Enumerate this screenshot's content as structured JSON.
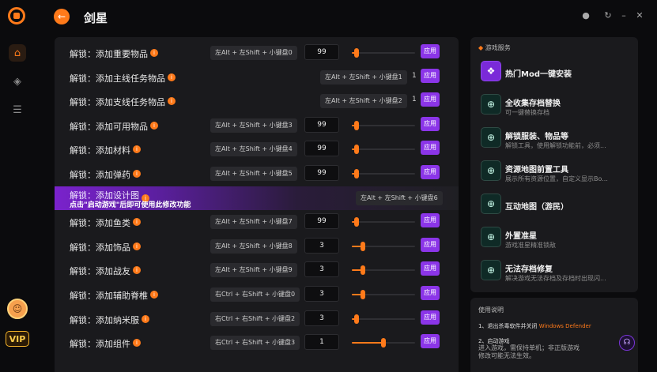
{
  "app": {
    "title": "剑星",
    "vip": "VIP"
  },
  "rows": [
    {
      "label": "解锁：添加重要物品",
      "keys": "左Alt + 左Shift + 小键盘0",
      "value": "99",
      "slider": 0.08,
      "apply": "应用"
    },
    {
      "label": "解锁：添加主线任务物品",
      "keys": "左Alt + 左Shift + 小键盘1",
      "count": "1",
      "apply": "应用"
    },
    {
      "label": "解锁：添加支线任务物品",
      "keys": "左Alt + 左Shift + 小键盘2",
      "count": "1",
      "apply": "应用"
    },
    {
      "label": "解锁：添加可用物品",
      "keys": "左Alt + 左Shift + 小键盘3",
      "value": "99",
      "slider": 0.08,
      "apply": "应用"
    },
    {
      "label": "解锁：添加材料",
      "keys": "左Alt + 左Shift + 小键盘4",
      "value": "99",
      "slider": 0.08,
      "apply": "应用"
    },
    {
      "label": "解锁：添加弹药",
      "keys": "左Alt + 左Shift + 小键盘5",
      "value": "99",
      "slider": 0.08,
      "apply": "应用"
    },
    {
      "label": "解锁：添加设计图",
      "sub": "点击\"启动游戏\"后即可使用此修改功能",
      "keys": "左Alt + 左Shift + 小键盘6",
      "highlight": true
    },
    {
      "label": "解锁：添加鱼类",
      "keys": "左Alt + 左Shift + 小键盘7",
      "value": "99",
      "slider": 0.08,
      "apply": "应用"
    },
    {
      "label": "解锁：添加饰品",
      "keys": "左Alt + 左Shift + 小键盘8",
      "value": "3",
      "slider": 0.18,
      "apply": "应用"
    },
    {
      "label": "解锁：添加战友",
      "keys": "左Alt + 左Shift + 小键盘9",
      "value": "3",
      "slider": 0.18,
      "apply": "应用"
    },
    {
      "label": "解锁：添加辅助脊椎",
      "keys": "右Ctrl + 右Shift + 小键盘0",
      "value": "3",
      "slider": 0.18,
      "apply": "应用"
    },
    {
      "label": "解锁：添加纳米服",
      "keys": "右Ctrl + 右Shift + 小键盘2",
      "value": "3",
      "slider": 0.08,
      "apply": "应用"
    },
    {
      "label": "解锁：添加组件",
      "keys": "右Ctrl + 右Shift + 小键盘3",
      "value": "1",
      "slider": 0.5,
      "apply": "应用"
    }
  ],
  "services": {
    "title": "游戏服务",
    "items": [
      {
        "name": "热门Mod一键安装",
        "desc": "",
        "icon": "mod-icon"
      },
      {
        "name": "全收集存档替换",
        "desc": "可一键替换存档",
        "icon": "download-icon"
      },
      {
        "name": "解锁服装、物品等",
        "desc": "解锁工具，使用解锁功能前，必须...",
        "icon": "unlock-icon"
      },
      {
        "name": "资源地图前置工具",
        "desc": "展示所有资源位置，自定义显示Bo...",
        "icon": "map-icon"
      },
      {
        "name": "互动地图（游民）",
        "desc": "",
        "icon": "map-pin-icon"
      },
      {
        "name": "外置准星",
        "desc": "游戏准星精准锁敌",
        "icon": "crosshair-icon"
      },
      {
        "name": "无法存档修复",
        "desc": "解决游戏无法存档及存档时出现闪...",
        "icon": "repair-icon"
      }
    ]
  },
  "usage": {
    "title": "使用说明",
    "step1_prefix": "1、退出杀毒软件并关闭 ",
    "step1_highlight": "Windows Defender",
    "step2_title": "2、启动游戏",
    "step2_text": "进入游戏，需保持单机；非正版游戏修改可能无法生效。"
  },
  "colors": {
    "accent": "#ff7a1a",
    "apply": "#8b35e8",
    "panel": "#1a1a1d",
    "bg": "#0b0b0d"
  }
}
